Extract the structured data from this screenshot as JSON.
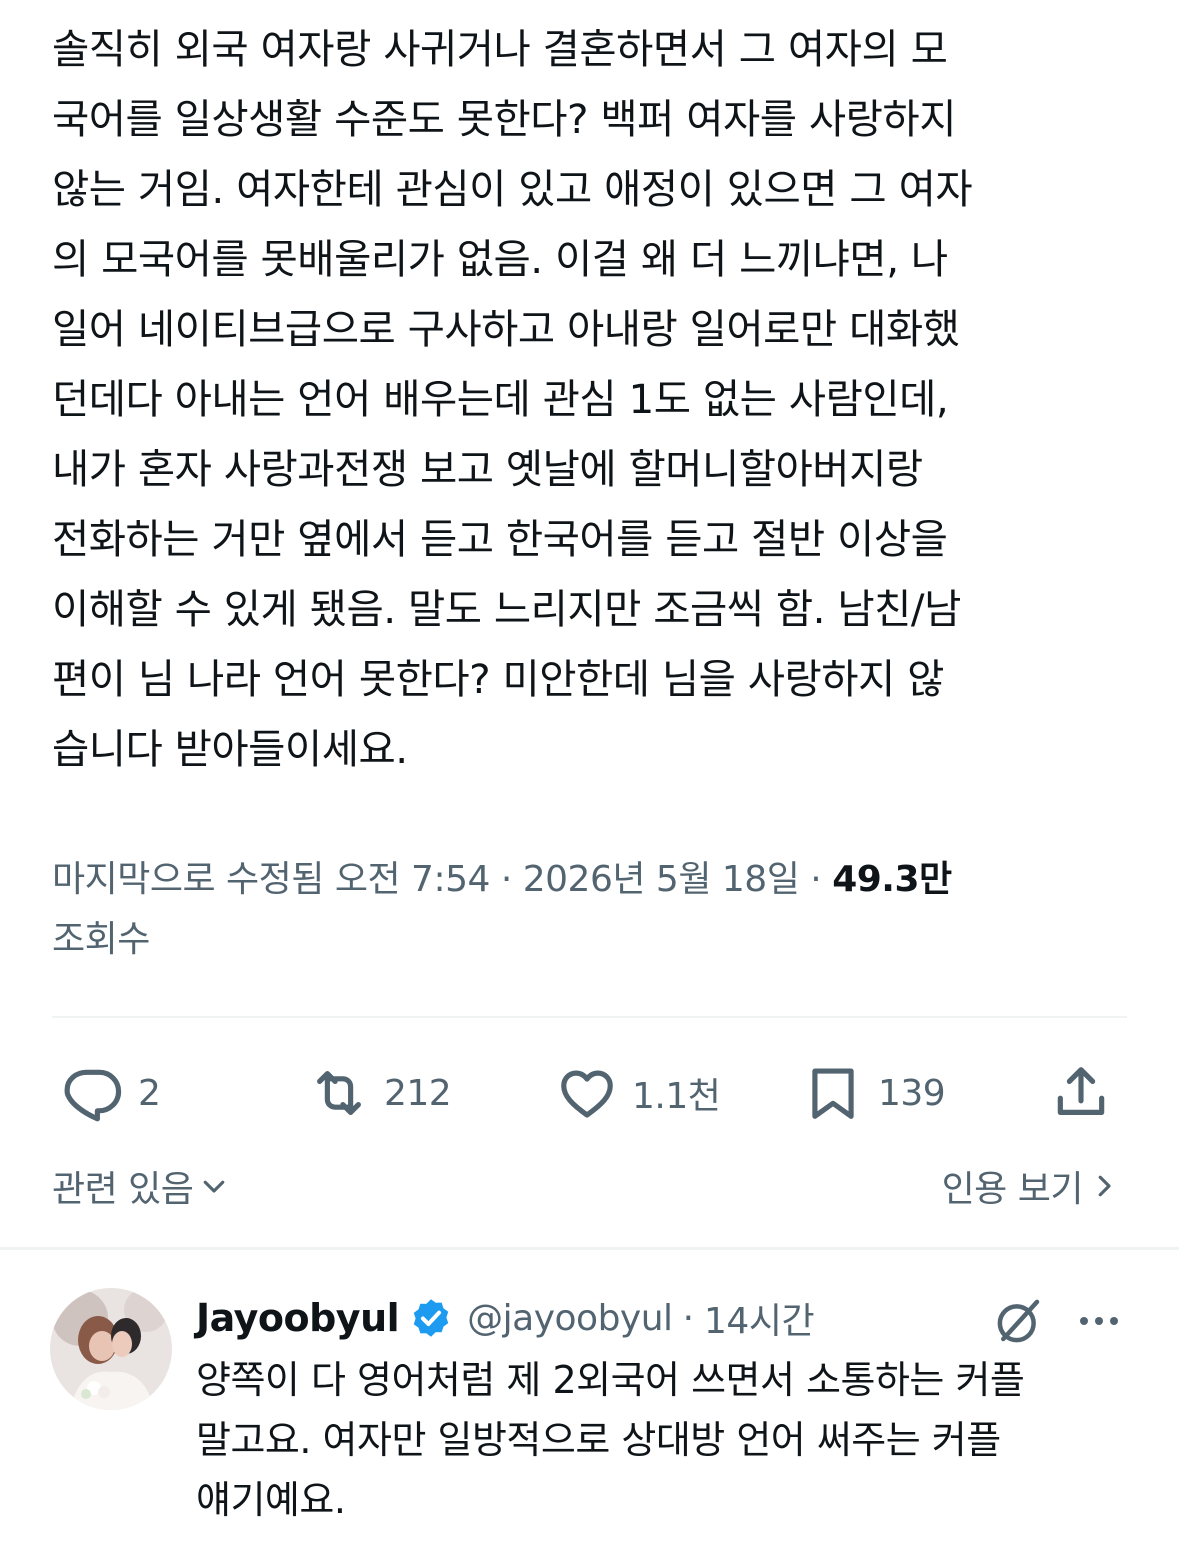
{
  "tweet": {
    "lines": [
      "솔직히 외국 여자랑 사귀거나 결혼하면서 그 여자의 모",
      "국어를 일상생활 수준도 못한다? 백퍼 여자를 사랑하지",
      "않는 거임. 여자한테 관심이 있고 애정이 있으면 그 여자",
      "의 모국어를 못배울리가 없음. 이걸 왜 더 느끼냐면, 나",
      "일어 네이티브급으로 구사하고 아내랑 일어로만 대화했",
      "던데다 아내는 언어 배우는데 관심 1도 없는 사람인데,",
      "내가 혼자 사랑과전쟁 보고 옛날에 할머니할아버지랑",
      "전화하는 거만 옆에서 듣고 한국어를 듣고 절반 이상을",
      "이해할 수 있게 됐음. 말도 느리지만 조금씩 함. 남친/남",
      "편이 님 나라 언어 못한다? 미안한데 님을 사랑하지 않",
      "습니다 받아들이세요."
    ],
    "edited_label": "마지막으로 수정됨",
    "time": "오전 7:54",
    "separator": "·",
    "date": "2026년 5월 18일",
    "views_count": "49.3만",
    "views_label": "조회수"
  },
  "actions": {
    "replies": "2",
    "retweets": "212",
    "likes": "1.1천",
    "bookmarks": "139"
  },
  "links": {
    "related": "관련 있음",
    "quotes": "인용 보기"
  },
  "reply": {
    "name": "Jayoobyul",
    "handle": "@jayoobyul",
    "separator": "·",
    "time": "14시간",
    "lines": [
      "양쪽이 다 영어처럼 제 2외국어 쓰면서 소통하는 커플",
      "말고요. 여자만 일방적으로 상대방 언어 써주는 커플",
      "얘기예요."
    ]
  },
  "colors": {
    "text": "#0f1419",
    "secondary": "#536471",
    "divider": "#eff3f4",
    "verified": "#1d9bf0"
  },
  "icons": {
    "reply": "reply-icon",
    "retweet": "retweet-icon",
    "like": "heart-icon",
    "bookmark": "bookmark-icon",
    "share": "share-icon",
    "verified": "verified-badge-icon",
    "grok": "grok-icon",
    "more": "more-icon"
  }
}
